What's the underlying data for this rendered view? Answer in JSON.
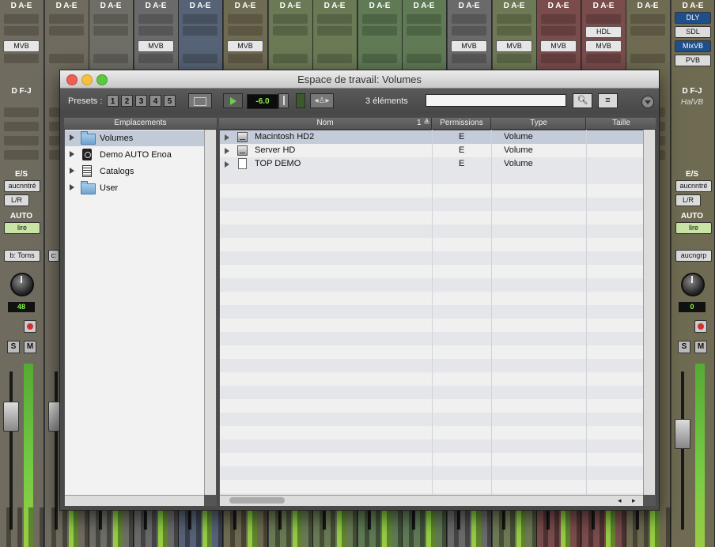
{
  "mixer": {
    "strips": [
      {
        "io": "D A-E",
        "color": "#6f6b5e",
        "insert": "MVB"
      },
      {
        "io": "D A-E",
        "color": "#6f6b5e",
        "insert": ""
      },
      {
        "io": "D A-E",
        "color": "#6e6e66",
        "insert": ""
      },
      {
        "io": "D A-E",
        "color": "#6a6a6a",
        "insert": "MVB"
      },
      {
        "io": "D A-E",
        "color": "#566275",
        "insert": ""
      },
      {
        "io": "D A-E",
        "color": "#6f6b52",
        "insert": "MVB"
      },
      {
        "io": "D A-E",
        "color": "#6a7a55",
        "insert": ""
      },
      {
        "io": "D A-E",
        "color": "#6a7a55",
        "insert": ""
      },
      {
        "io": "D A-E",
        "color": "#5f7a55",
        "insert": ""
      },
      {
        "io": "D A-E",
        "color": "#5f7a55",
        "insert": ""
      },
      {
        "io": "D A-E",
        "color": "#6a6a6a",
        "insert": "MVB"
      },
      {
        "io": "D A-E",
        "color": "#6e7a55",
        "insert": "MVB"
      },
      {
        "io": "D A-E",
        "color": "#7a4c4c",
        "insert": "MVB"
      },
      {
        "io": "D A-E",
        "color": "#7a4c4c",
        "insert": "MVB",
        "insert2": "HDL"
      },
      {
        "io": "D A-E",
        "color": "#6f6b52",
        "insert": ""
      }
    ],
    "left": {
      "input": "D F-J",
      "io_label": "E/S",
      "io_in": "aucnntré",
      "io_out": "L/R",
      "auto_label": "AUTO",
      "auto_mode": "lire",
      "group": "b: Toms",
      "pan_value": "48",
      "solo": "S",
      "mute": "M",
      "neighbor_group": "c:"
    },
    "right": {
      "io_header": "D A-E",
      "inserts": [
        "DLY",
        "SDL",
        "MixVB",
        "PVB"
      ],
      "input": "D F-J",
      "input_sub": "HalVB",
      "io_label": "E/S",
      "io_in": "aucnntré",
      "io_out": "L/R",
      "auto_label": "AUTO",
      "auto_mode": "lire",
      "group": "aucngrp",
      "pan_value": "0",
      "solo": "S",
      "mute": "M"
    }
  },
  "window": {
    "title": "Espace de travail: Volumes",
    "toolbar": {
      "presets_label": "Presets :",
      "presets": [
        "1",
        "2",
        "3",
        "4",
        "5"
      ],
      "level": "-6.0",
      "item_count": "3 éléments",
      "search_value": ""
    },
    "locations": {
      "header": "Emplacements",
      "items": [
        {
          "label": "Volumes",
          "icon": "folder-icon",
          "selected": true
        },
        {
          "label": "Demo AUTO Enoa",
          "icon": "disk-icon",
          "selected": false
        },
        {
          "label": "Catalogs",
          "icon": "catalog-icon",
          "selected": false
        },
        {
          "label": "User",
          "icon": "folder-icon",
          "selected": false
        }
      ]
    },
    "files": {
      "columns": {
        "name": "Nom",
        "sort": "1 ≜",
        "permissions": "Permissions",
        "type": "Type",
        "size": "Taille"
      },
      "rows": [
        {
          "name": "Macintosh HD2",
          "permissions": "E",
          "type": "Volume",
          "icon": "hard-drive-icon"
        },
        {
          "name": "Server HD",
          "permissions": "E",
          "type": "Volume",
          "icon": "hard-drive-icon"
        },
        {
          "name": "TOP DEMO",
          "permissions": "E",
          "type": "Volume",
          "icon": "blank-volume-icon"
        }
      ]
    }
  }
}
